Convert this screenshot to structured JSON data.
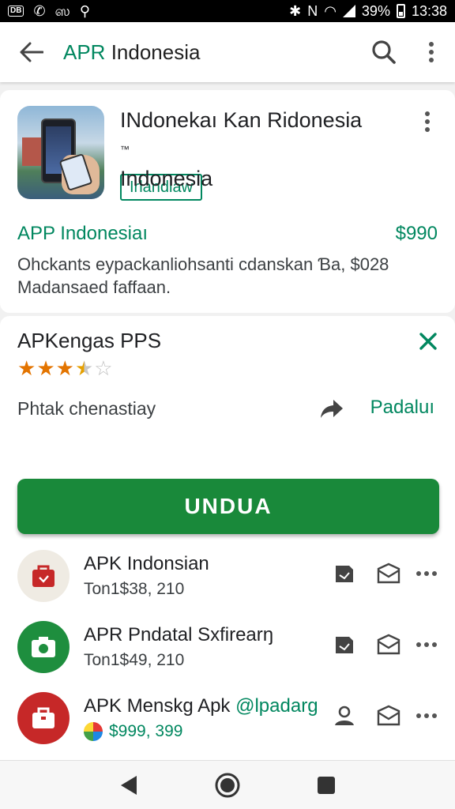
{
  "status_bar": {
    "badge": "DB",
    "battery": "39%",
    "time": "13:38",
    "left_glyphs": [
      "ஸ"
    ]
  },
  "app_bar": {
    "title_green": "APR",
    "title_rest": "Indonesia"
  },
  "app": {
    "title_line1": "INdonekaı Kan Ridonesia",
    "title_tm": "™",
    "title_line2": "Indonesia",
    "chip": "Irlandlaw",
    "developer": "APP Indonesiaı",
    "price": "$990",
    "description": "Ohckants eypackanliohsanti cdanskan Ɓa, $028 Madansaed  faffaan."
  },
  "review": {
    "title": "APKengas PPS",
    "rating": 3.5,
    "rating_max": 5,
    "subtitle": "Phtak chenastiay",
    "share_label": "Padaluı"
  },
  "install_button": "UNDUA",
  "list": [
    {
      "title": "APK Indonsian",
      "subtitle": "Ton1$38, 210",
      "icon": "shopping-bag-icon",
      "color": "#c62828",
      "bg": "#efebe3",
      "actions": [
        "folder-icon",
        "inbox-icon",
        "more-icon"
      ]
    },
    {
      "title": "APR Pndatal Sxfirearŋ",
      "subtitle": "Ton1$49, 210",
      "icon": "camera-icon",
      "color": "#ffffff",
      "bg": "#1e8e3e",
      "actions": [
        "folder-icon",
        "inbox-icon",
        "more-icon"
      ]
    },
    {
      "title": "APK Menskɡ Apk",
      "title_green": "@lpadarg",
      "subtitle": "$999, 399",
      "icon": "briefcase-icon",
      "color": "#ffffff",
      "bg": "#c62828",
      "actions": [
        "person-icon",
        "inbox-icon",
        "more-icon"
      ]
    }
  ],
  "colors": {
    "accent": "#01875f",
    "install": "#19893a",
    "star": "#e37400"
  }
}
